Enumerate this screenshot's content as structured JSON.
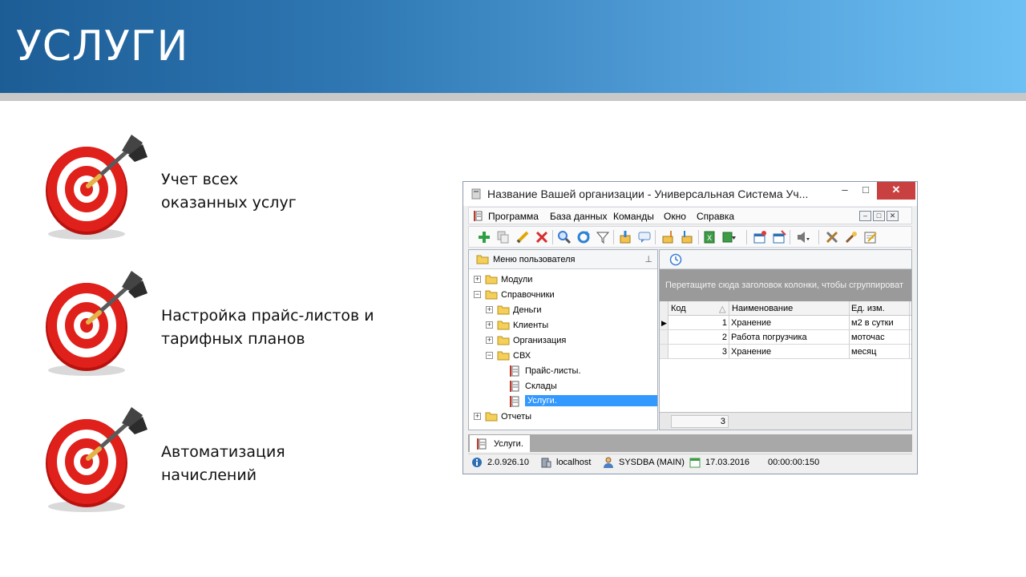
{
  "slide": {
    "title": "УСЛУГИ",
    "bullets": [
      {
        "line1": "Учет всех",
        "line2": "оказанных услуг"
      },
      {
        "line1": "Настройка прайс-листов и",
        "line2": "тарифных планов"
      },
      {
        "line1": "Автоматизация",
        "line2": "начислений"
      }
    ]
  },
  "window": {
    "title": "Название Вашей организации - Универсальная Система Уч...",
    "controls": {
      "minimize": "–",
      "maximize": "□",
      "close": "✕"
    },
    "menu": [
      "Программа",
      "База данных",
      "Команды",
      "Окно",
      "Справка"
    ],
    "left_pane": {
      "header": "Меню пользователя",
      "tree": [
        {
          "label": "Модули",
          "expander": "+",
          "type": "folder"
        },
        {
          "label": "Справочники",
          "expander": "−",
          "type": "folder"
        },
        {
          "label": "Деньги",
          "expander": "+",
          "type": "folder"
        },
        {
          "label": "Клиенты",
          "expander": "+",
          "type": "folder"
        },
        {
          "label": "Организация",
          "expander": "+",
          "type": "folder"
        },
        {
          "label": "СВХ",
          "expander": "−",
          "type": "folder"
        },
        {
          "label": "Прайс-листы.",
          "type": "doc"
        },
        {
          "label": "Склады",
          "type": "doc"
        },
        {
          "label": "Услуги.",
          "type": "doc",
          "selected": true
        },
        {
          "label": "Отчеты",
          "expander": "+",
          "type": "folder"
        }
      ]
    },
    "grid": {
      "group_hint": "Перетащите сюда заголовок колонки, чтобы сгруппироват",
      "columns": [
        "Код",
        "Наименование",
        "Ед. изм."
      ],
      "sort_glyph": "△",
      "rows": [
        {
          "code": "1",
          "name": "Хранение",
          "unit": "м2 в сутки"
        },
        {
          "code": "2",
          "name": "Работа погрузчика",
          "unit": "моточас"
        },
        {
          "code": "3",
          "name": "Хранение",
          "unit": "месяц"
        }
      ],
      "footer_count": "3"
    },
    "tab": "Услуги.",
    "status": {
      "version": "2.0.926.10",
      "host": "localhost",
      "user": "SYSDBA (MAIN)",
      "date": "17.03.2016",
      "time": "00:00:00:150"
    }
  },
  "colors": {
    "banner_start": "#1d5d96",
    "banner_end": "#6cc0f3",
    "target_red": "#e0201b",
    "selection": "#3399ff",
    "close_button": "#c94040"
  }
}
